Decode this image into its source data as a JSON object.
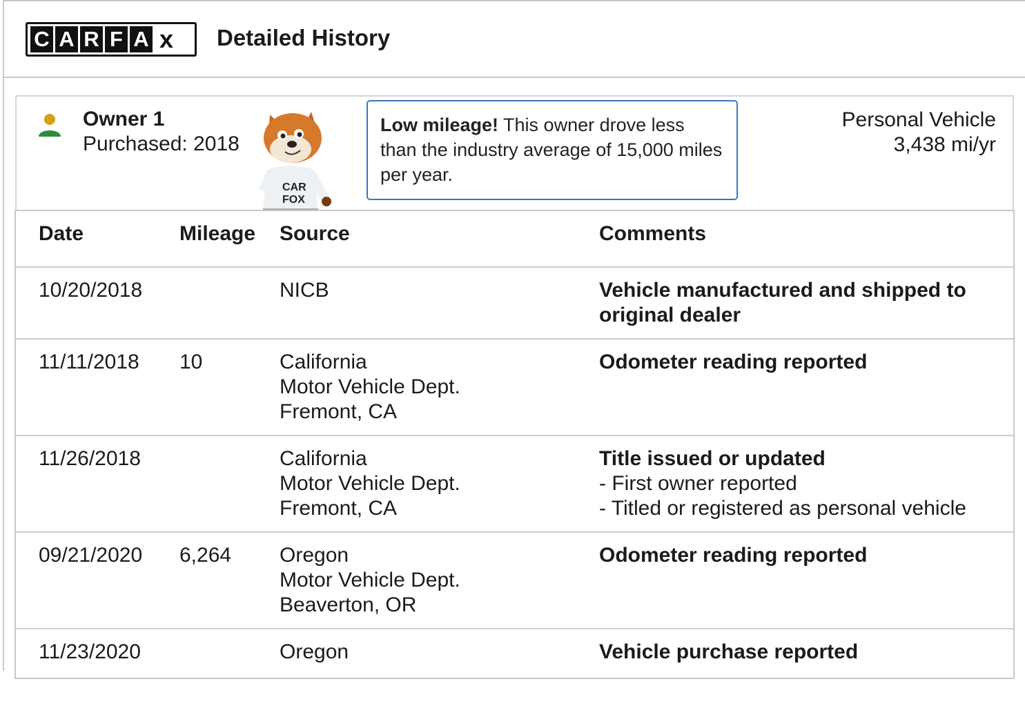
{
  "header": {
    "logo_letters": [
      "C",
      "A",
      "R",
      "F",
      "A"
    ],
    "logo_x": "x",
    "title": "Detailed History"
  },
  "owner": {
    "name": "Owner 1",
    "purchased": "Purchased: 2018",
    "tip_bold": "Low mileage!",
    "tip_text": " This owner drove less than the industry average of 15,000 miles per year.",
    "vehicle_type": "Personal Vehicle",
    "mileage_per_year": "3,438 mi/yr",
    "fox_shirt_text": [
      "CAR",
      "FOX"
    ]
  },
  "table": {
    "columns": {
      "date": "Date",
      "mileage": "Mileage",
      "source": "Source",
      "comments": "Comments"
    },
    "rows": [
      {
        "date": "10/20/2018",
        "mileage": "",
        "source": [
          "NICB"
        ],
        "comment_title": "Vehicle manufactured and shipped to original dealer",
        "comment_lines": []
      },
      {
        "date": "11/11/2018",
        "mileage": "10",
        "source": [
          "California",
          "Motor Vehicle Dept.",
          "Fremont, CA"
        ],
        "comment_title": "Odometer reading reported",
        "comment_lines": []
      },
      {
        "date": "11/26/2018",
        "mileage": "",
        "source": [
          "California",
          "Motor Vehicle Dept.",
          "Fremont, CA"
        ],
        "comment_title": "Title issued or updated",
        "comment_lines": [
          "- First owner reported",
          "- Titled or registered as personal vehicle"
        ]
      },
      {
        "date": "09/21/2020",
        "mileage": "6,264",
        "source": [
          "Oregon",
          "Motor Vehicle Dept.",
          "Beaverton, OR"
        ],
        "comment_title": "Odometer reading reported",
        "comment_lines": []
      },
      {
        "date": "11/23/2020",
        "mileage": "",
        "source": [
          "Oregon"
        ],
        "comment_title": "Vehicle purchase reported",
        "comment_lines": []
      }
    ]
  },
  "colors": {
    "person_head": "#d4a017",
    "person_body": "#2e8b3e",
    "tip_border": "#3777bc"
  }
}
